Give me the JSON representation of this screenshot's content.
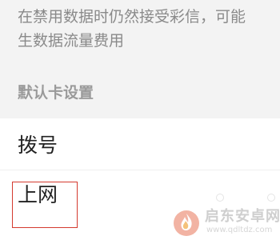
{
  "description": {
    "line1": "在禁用数据时仍然接受彩信，可能",
    "line2": "生数据流量费用"
  },
  "section_header": "默认卡设置",
  "items": [
    {
      "label": "拨号",
      "icon": "none"
    },
    {
      "label": "上网",
      "icon": "none"
    }
  ],
  "highlight": {
    "target": "上网",
    "color": "#d43a2f"
  },
  "watermark": {
    "logo": "flame-logo-icon",
    "title": "启东安卓网",
    "url": "www.qdltdz.com"
  },
  "colors": {
    "section_background": "#f3f3f3",
    "item_background": "#ffffff",
    "primary_text": "#222222",
    "secondary_text": "#8a8a8a",
    "highlight_border": "#d43a2f"
  }
}
